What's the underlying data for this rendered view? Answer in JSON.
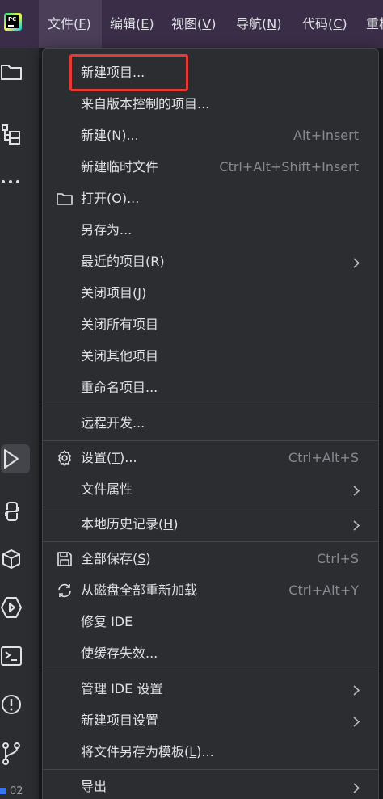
{
  "app": {
    "logo_text": "PC"
  },
  "main_menu": [
    {
      "label": "文件(",
      "mnemonic": "F",
      "suffix": ")"
    },
    {
      "label": "编辑(",
      "mnemonic": "E",
      "suffix": ")"
    },
    {
      "label": "视图(",
      "mnemonic": "V",
      "suffix": ")"
    },
    {
      "label": "导航(",
      "mnemonic": "N",
      "suffix": ")"
    },
    {
      "label": "代码(",
      "mnemonic": "C",
      "suffix": ")"
    },
    {
      "label": "重构",
      "mnemonic": "",
      "suffix": ""
    }
  ],
  "status": {
    "left_text": "02"
  },
  "file_menu": {
    "new_project": "新建项目...",
    "from_vcs": "来自版本控制的项目...",
    "new": {
      "pre": "新建(",
      "mn": "N",
      "post": ")...",
      "shortcut": "Alt+Insert"
    },
    "new_scratch": {
      "label": "新建临时文件",
      "shortcut": "Ctrl+Alt+Shift+Insert"
    },
    "open": {
      "pre": "打开(",
      "mn": "O",
      "post": ")..."
    },
    "save_as": "另存为...",
    "recent": {
      "pre": "最近的项目(",
      "mn": "R",
      "post": ")"
    },
    "close_project": {
      "pre": "关闭项目(",
      "mn": "J",
      "post": ")"
    },
    "close_all": "关闭所有项目",
    "close_others": "关闭其他项目",
    "rename": "重命名项目...",
    "remote_dev": "远程开发...",
    "settings": {
      "pre": "设置(",
      "mn": "T",
      "post": ")...",
      "shortcut": "Ctrl+Alt+S"
    },
    "file_props": "文件属性",
    "local_history": {
      "pre": "本地历史记录(",
      "mn": "H",
      "post": ")"
    },
    "save_all": {
      "pre": "全部保存(",
      "mn": "S",
      "post": ")",
      "shortcut": "Ctrl+S"
    },
    "reload": {
      "label": "从磁盘全部重新加载",
      "shortcut": "Ctrl+Alt+Y"
    },
    "repair": "修复 IDE",
    "invalidate": "使缓存失效...",
    "manage_settings": "管理 IDE 设置",
    "new_project_settings": "新建项目设置",
    "save_template": {
      "pre": "将文件另存为模板(",
      "mn": "L",
      "post": ")..."
    },
    "export": "导出"
  },
  "colors": {
    "titlebar": "#3a2d47",
    "menu_bg": "#2b2d30",
    "highlight": "#e53935",
    "text": "#dfe1e5",
    "shortcut": "#868a91"
  }
}
